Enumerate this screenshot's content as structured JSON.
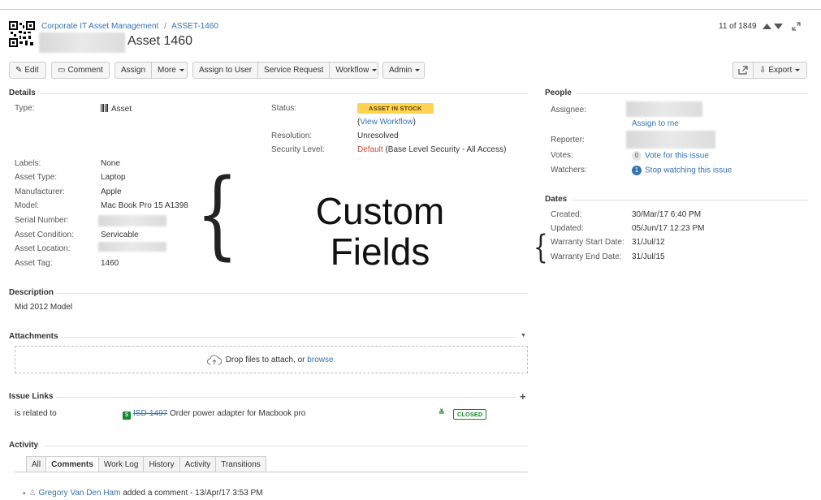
{
  "breadcrumb": {
    "project": "Corporate IT Asset Management",
    "issue_key": "ASSET-1460"
  },
  "issue": {
    "title": "Asset 1460"
  },
  "pager": {
    "text": "11 of 1849"
  },
  "toolbar": {
    "edit": "Edit",
    "comment": "Comment",
    "assign": "Assign",
    "more": "More",
    "assign_to_user": "Assign to User",
    "service_request": "Service Request",
    "workflow": "Workflow",
    "admin": "Admin",
    "export": "Export"
  },
  "details": {
    "heading": "Details",
    "type_label": "Type:",
    "type_value": "Asset",
    "status_label": "Status:",
    "status_value": "ASSET IN STOCK",
    "view_workflow_open": "(",
    "view_workflow": "View Workflow",
    "view_workflow_close": ")",
    "resolution_label": "Resolution:",
    "resolution_value": "Unresolved",
    "security_label": "Security Level:",
    "security_default": "Default",
    "security_value": "(Base Level Security - All Access)",
    "labels_label": "Labels:",
    "labels_value": "None",
    "asset_type_label": "Asset Type:",
    "asset_type_value": "Laptop",
    "manufacturer_label": "Manufacturer:",
    "manufacturer_value": "Apple",
    "model_label": "Model:",
    "model_value": "Mac Book Pro 15 A1398",
    "serial_label": "Serial Number:",
    "condition_label": "Asset Condition:",
    "condition_value": "Servicable",
    "location_label": "Asset Location:",
    "tag_label": "Asset Tag:",
    "tag_value": "1460"
  },
  "annotation": {
    "line1": "Custom",
    "line2": "Fields"
  },
  "description": {
    "heading": "Description",
    "text": "Mid 2012 Model"
  },
  "attachments": {
    "heading": "Attachments",
    "drop_text": "Drop files to attach, or ",
    "browse": "browse."
  },
  "issue_links": {
    "heading": "Issue Links",
    "relation": "is related to",
    "linked_key": "ISD-1497",
    "linked_summary": "Order power adapter for Macbook pro",
    "linked_status": "CLOSED"
  },
  "activity": {
    "heading": "Activity",
    "tabs": [
      "All",
      "Comments",
      "Work Log",
      "History",
      "Activity",
      "Transitions"
    ],
    "comment_author": "Gregory Van Den Ham",
    "comment_meta": "added a comment - 13/Apr/17 3:53 PM"
  },
  "people": {
    "heading": "People",
    "assignee_label": "Assignee:",
    "assign_to_me": "Assign to me",
    "reporter_label": "Reporter:",
    "votes_label": "Votes:",
    "votes_count": "0",
    "vote_link": "Vote for this issue",
    "watchers_label": "Watchers:",
    "watchers_count": "1",
    "watch_link": "Stop watching this issue"
  },
  "dates": {
    "heading": "Dates",
    "created_label": "Created:",
    "created_value": "30/Mar/17 6:40 PM",
    "updated_label": "Updated:",
    "updated_value": "05/Jun/17 12:23 PM",
    "warranty_start_label": "Warranty Start Date:",
    "warranty_start_value": "31/Jul/12",
    "warranty_end_label": "Warranty End Date:",
    "warranty_end_value": "31/Jul/15"
  },
  "colors": {
    "link": "#3572b0",
    "lozenge": "#ffd351",
    "closed": "#14892c",
    "default_red": "#d04437"
  }
}
